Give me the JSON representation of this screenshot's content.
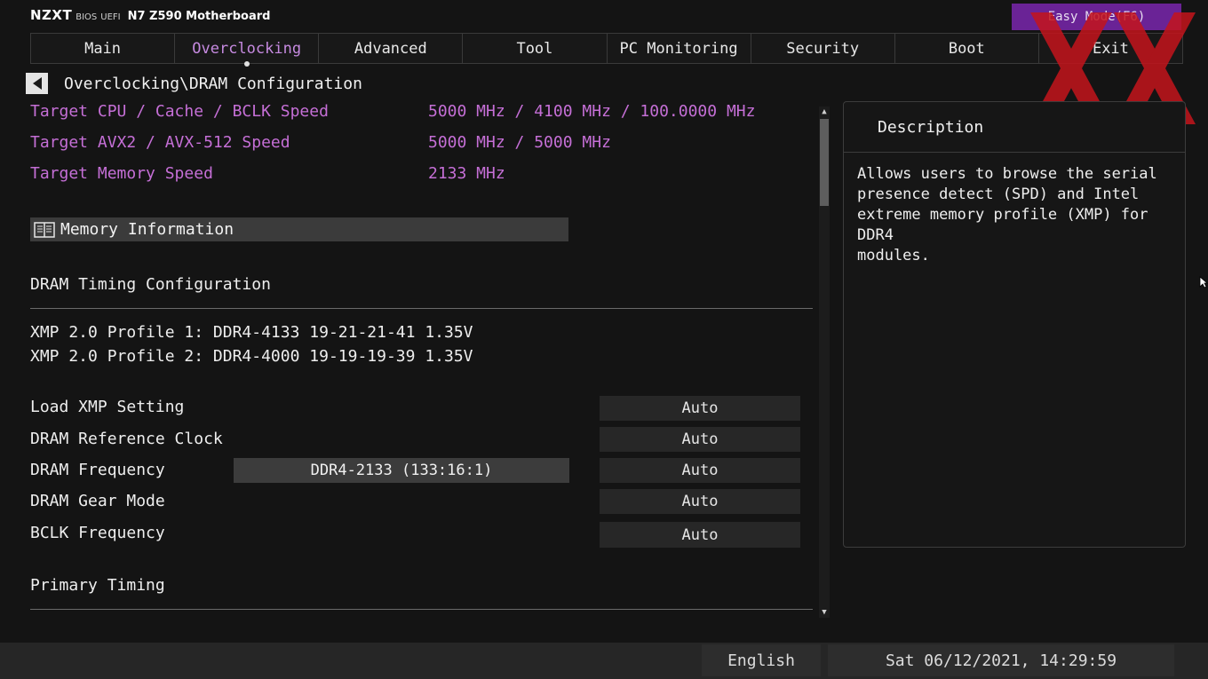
{
  "header": {
    "logo": "NZXT",
    "bios": "BIOS",
    "uefi": "UEFI",
    "model": "N7 Z590 Motherboard",
    "easy_mode": "Easy Mode(F6)"
  },
  "tabs": [
    {
      "label": "Main"
    },
    {
      "label": "Overclocking",
      "active": true
    },
    {
      "label": "Advanced"
    },
    {
      "label": "Tool"
    },
    {
      "label": "PC Monitoring"
    },
    {
      "label": "Security"
    },
    {
      "label": "Boot"
    },
    {
      "label": "Exit"
    }
  ],
  "breadcrumb": "Overclocking\\DRAM Configuration",
  "targets": [
    {
      "label": "Target CPU / Cache / BCLK Speed",
      "value": "5000 MHz / 4100 MHz / 100.0000 MHz"
    },
    {
      "label": "Target AVX2 / AVX-512 Speed",
      "value": "5000 MHz / 5000 MHz"
    },
    {
      "label": "Target Memory Speed",
      "value": "2133 MHz"
    }
  ],
  "memory_information": "Memory Information",
  "sections": {
    "dram_timing": "DRAM Timing Configuration",
    "primary_timing": "Primary Timing"
  },
  "xmp_profiles": [
    "XMP 2.0 Profile 1: DDR4-4133 19-21-21-41 1.35V",
    "XMP 2.0 Profile 2: DDR4-4000 19-19-19-39 1.35V"
  ],
  "settings": [
    {
      "label": "Load XMP Setting",
      "value": "Auto"
    },
    {
      "label": "DRAM Reference Clock",
      "value": "Auto"
    },
    {
      "label": "DRAM Frequency",
      "value": "Auto",
      "readout": "DDR4-2133 (133:16:1)"
    },
    {
      "label": "DRAM Gear Mode",
      "value": "Auto"
    },
    {
      "label": "BCLK Frequency",
      "value": "Auto"
    }
  ],
  "description": {
    "title": "Description",
    "text": "Allows users to browse the serial\npresence detect (SPD) and Intel\nextreme memory profile (XMP) for DDR4\nmodules."
  },
  "status": {
    "language": "English",
    "datetime": "Sat 06/12/2021, 14:29:59"
  },
  "colors": {
    "accent_purple": "#c56fd6",
    "easy_mode_bg": "#6a2396",
    "watermark_red": "#c4141c"
  }
}
